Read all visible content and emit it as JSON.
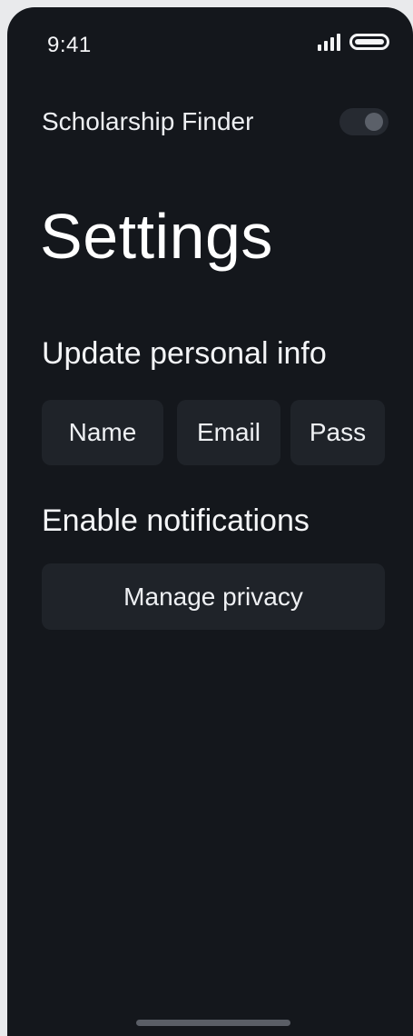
{
  "status_bar": {
    "time": "9:41",
    "signal_icon": "cellular-signal-icon",
    "battery_icon": "battery-icon"
  },
  "header": {
    "app_title": "Scholarship Finder",
    "toggle_state": "off"
  },
  "page": {
    "title": "Settings"
  },
  "personal_info": {
    "heading": "Update personal info",
    "buttons": [
      {
        "label": "Name"
      },
      {
        "label": "Email"
      },
      {
        "label": "Pass"
      }
    ]
  },
  "notifications": {
    "heading": "Enable notifications",
    "privacy_button": "Manage privacy"
  },
  "colors": {
    "background": "#14171c",
    "surface": "#1f2329",
    "text": "#f4f5f7",
    "toggle_track": "#262a31",
    "toggle_knob": "#5b6069"
  }
}
